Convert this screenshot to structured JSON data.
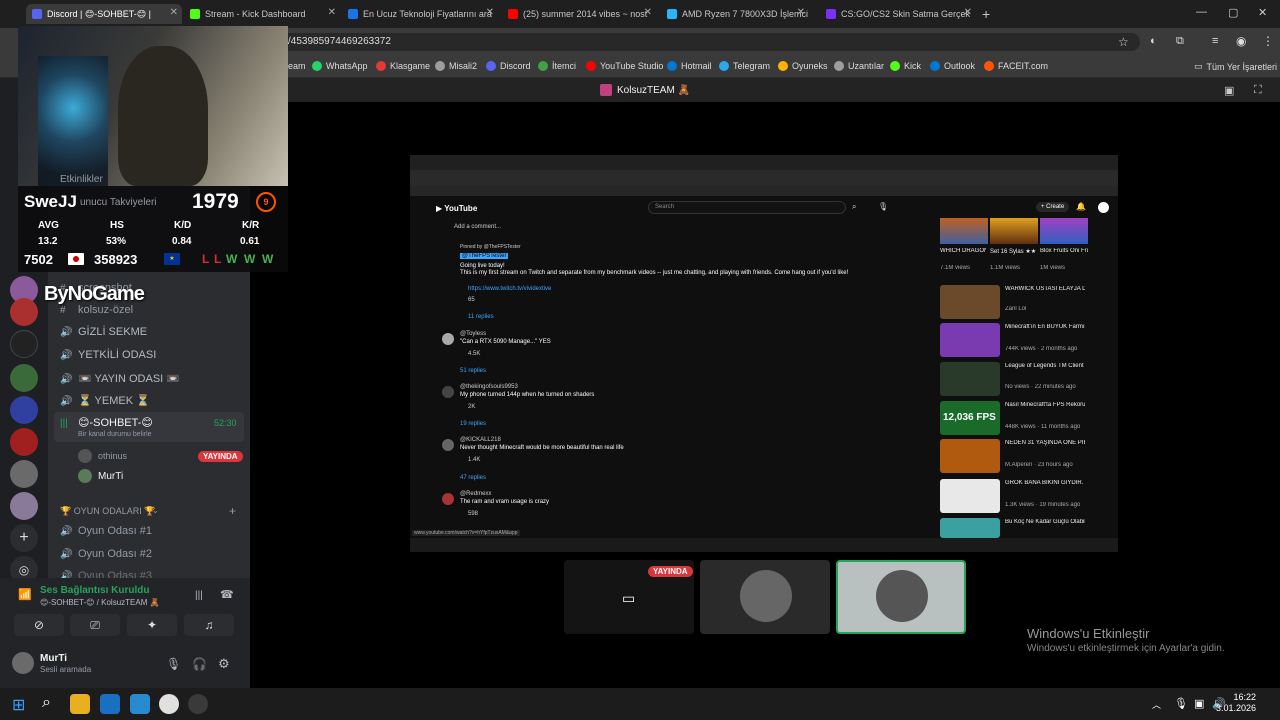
{
  "tabs": [
    {
      "label": "Discord | 😊-SOHBET-😊 |",
      "color": "#5865f2",
      "active": true
    },
    {
      "label": "Stream - Kick Dashboard",
      "color": "#53fc18"
    },
    {
      "label": "En Ucuz Teknoloji Fiyatlarını ara",
      "color": "#1a73e8"
    },
    {
      "label": "(25) summer 2014 vibes ~ nost",
      "color": "#ff0000"
    },
    {
      "label": "AMD Ryzen 7 7800X3D İşlemci",
      "color": "#29b6f6"
    },
    {
      "label": "CS:GO/CS2 Skin Satma Gerçek",
      "color": "#7b2ff7"
    }
  ],
  "address": "/453985974469263372",
  "bookmarks": [
    {
      "label": "eam",
      "color": "#555"
    },
    {
      "label": "WhatsApp",
      "color": "#25d366"
    },
    {
      "label": "Klasgame",
      "color": "#e53935"
    },
    {
      "label": "Misali2",
      "color": "#9e9e9e"
    },
    {
      "label": "Discord",
      "color": "#5865f2"
    },
    {
      "label": "İtemci",
      "color": "#43a047"
    },
    {
      "label": "YouTube Studio",
      "color": "#ff0000"
    },
    {
      "label": "Hotmail",
      "color": "#0078d4"
    },
    {
      "label": "Telegram",
      "color": "#29a9eb"
    },
    {
      "label": "Oyuneks",
      "color": "#ffb300"
    },
    {
      "label": "Uzantılar",
      "color": "#9e9e9e"
    },
    {
      "label": "Kick",
      "color": "#53fc18"
    },
    {
      "label": "Outlook",
      "color": "#0078d4"
    },
    {
      "label": "FACEIT.com",
      "color": "#ff5500"
    }
  ],
  "all_bookmarks": "Tüm Yer İşaretleri",
  "stream_title": "KolsuzTEAM 🧸",
  "overlay": {
    "name": "SweJJ",
    "elo": "1979",
    "level": "9",
    "headers": [
      "AVG",
      "HS",
      "K/D",
      "K/R"
    ],
    "values": [
      "13.2",
      "53%",
      "0.84",
      "0.61"
    ],
    "rank1": "7502",
    "rank2": "358923",
    "form": [
      "L",
      "L",
      "W",
      "W",
      "W"
    ],
    "brand": "ByNoGame",
    "events_label": "Etkinlikler",
    "boosts_label": "unucu Takviyeleri"
  },
  "channels": [
    {
      "name": "screenshot",
      "type": "text"
    },
    {
      "name": "kolsuz-özel",
      "type": "text"
    },
    {
      "name": "GİZLİ SEKME",
      "type": "voice"
    },
    {
      "name": "YETKİLİ ODASI",
      "type": "voice"
    },
    {
      "name": "📼 YAYIN ODASI 📼",
      "type": "voice"
    },
    {
      "name": "⏳ YEMEK ⏳",
      "type": "voice"
    }
  ],
  "active_voice": {
    "name": "😊-SOHBET-😊",
    "timer": "52:30",
    "status": "Bir kanal durumu belirle"
  },
  "voice_users": [
    {
      "name": "othinus",
      "badge": "YAYINDA"
    },
    {
      "name": "MurTi",
      "badge": ""
    }
  ],
  "category": "🏆 OYUN ODALARI 🏆",
  "game_rooms": [
    "Oyun Odası #1",
    "Oyun Odası #2",
    "Oyun Odası #3"
  ],
  "voice_panel": {
    "connected": "Ses Bağlantısı Kuruldu",
    "location": "😊-SOHBET-😊 / KolsuzTEAM 🧸",
    "user": "MurTi",
    "user_status": "Sesli aramada"
  },
  "youtube": {
    "url": "www.youtube.com/watch?v=hYfpTzuxAM&app",
    "search_placeholder": "Search",
    "create": "+ Create",
    "add_comment": "Add a comment...",
    "pinned": "Pinned by @TheFPSTester",
    "comments": [
      {
        "author": "@TheFPSTester",
        "text": "Going live today!",
        "text2": "This is my first stream on Twitch and separate from my benchmark videos -- just me chatting, and playing with friends. Come hang out if you'd like!",
        "link": "https://www.twitch.tv/vividextive",
        "likes": "65",
        "replies": "11 replies"
      },
      {
        "author": "@Toyless",
        "text": "\"Can a RTX 5090 Manage...\" YES",
        "likes": "4.5K",
        "replies": "51 replies"
      },
      {
        "author": "@thekingofsouls9953",
        "text": "My phone turned 144p when he turned on shaders",
        "likes": "2K",
        "replies": "19 replies"
      },
      {
        "author": "@KICKALL218",
        "text": "Never thought Minecraft would be more beautiful than real life",
        "likes": "1.4K",
        "replies": "47 replies"
      },
      {
        "author": "@Redmexx",
        "text": "The ram and vram usage is crazy",
        "likes": "598",
        "replies": ""
      }
    ],
    "top_recs": [
      {
        "title": "WHICH DRAGON ...",
        "meta": "7.1M views"
      },
      {
        "title": "Set 16 Sylas ★★★ ...",
        "meta": "1.1M views"
      },
      {
        "title": "Blox Fruits Oni Fruit | ...",
        "meta": "1M views"
      }
    ],
    "recs": [
      {
        "title": "WARWICK USTASI ELAYJA DÜŞÜK ELODA KIŞKIRTMA...",
        "meta": "Zanl Lol",
        "color": "#6a4a2a"
      },
      {
        "title": "Minecraft'ın En BÜYÜK Farmını Yaptım | Hardcore 8",
        "meta": "744K views · 2 months ago",
        "color": "#7a3ab0"
      },
      {
        "title": "League of Legends TM Client 2019 10 28 17 20 21 Final ge...",
        "meta": "No views · 22 minutes ago",
        "color": "#2a3a2a"
      },
      {
        "title": "Nasıl Minecraft'ta FPS Rekorumu Kırdım? (12.000 FPS)",
        "meta": "448K views · 11 months ago",
        "color": "#1a6a2a"
      },
      {
        "title": "NEDEN 31 YAŞINDA ONE PIECE İZLEMEYE KADAR GELDİM?",
        "meta": "M.Alperen · 23 hours ago",
        "color": "#b05a10"
      },
      {
        "title": "GROK BANA BİKİNİ GİYDİR. (rezillik)",
        "meta": "1.3K views · 19 minutes ago",
        "color": "#e8e8e8"
      },
      {
        "title": "Bu Köç Ne Kadar Güçlü Olabilir? | Terraria",
        "meta": "",
        "color": "#3aa0a0"
      }
    ],
    "fps_overlay": "12,036 FPS"
  },
  "call_thumbs": [
    {
      "label": "YAYINDA"
    },
    {
      "label": ""
    },
    {
      "label": ""
    }
  ],
  "watermark": {
    "line1": "Windows'u Etkinleştir",
    "line2": "Windows'u etkinleştirmek için Ayarlar'a gidin."
  },
  "clock": {
    "time": "16:22",
    "date": "3.01.2026"
  }
}
